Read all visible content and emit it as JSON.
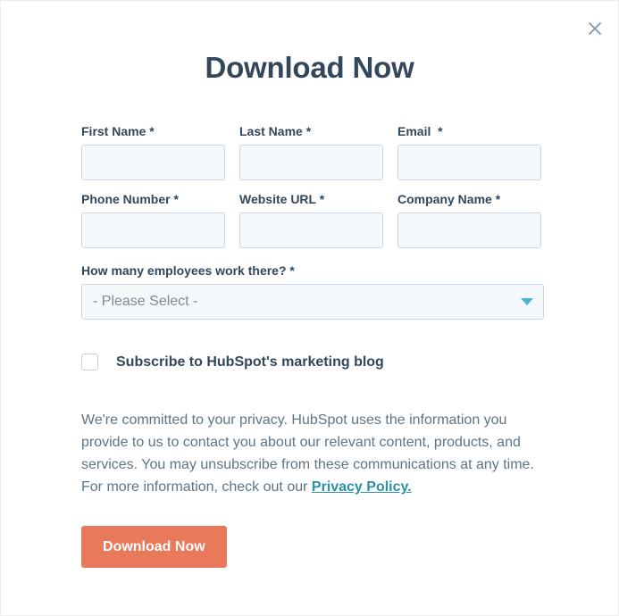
{
  "modal": {
    "title": "Download Now",
    "close_icon": "close-icon",
    "close_label": "Close"
  },
  "form": {
    "rows": [
      {
        "fields": [
          {
            "label": "First Name *",
            "value": "",
            "placeholder": "",
            "name": "first-name"
          },
          {
            "label": "Last Name *",
            "value": "",
            "placeholder": "",
            "name": "last-name"
          },
          {
            "label": "Email  *",
            "value": "",
            "placeholder": "",
            "name": "email"
          }
        ]
      },
      {
        "fields": [
          {
            "label": "Phone Number *",
            "value": "",
            "placeholder": "",
            "name": "phone-number"
          },
          {
            "label": "Website URL *",
            "value": "",
            "placeholder": "",
            "name": "website-url"
          },
          {
            "label": "Company Name *",
            "value": "",
            "placeholder": "",
            "name": "company-name"
          }
        ]
      }
    ],
    "select": {
      "label": "How many employees work there? *",
      "selected": "- Please Select -",
      "caret_icon": "chevron-down-icon"
    },
    "checkbox": {
      "label": "Subscribe to HubSpot's marketing blog",
      "checked": false
    },
    "privacy": {
      "text": "We're committed to your privacy. HubSpot uses the information you provide to us to contact you about our relevant content, products, and services. You may unsubscribe from these communications at any time. For more information, check out our ",
      "link_text": "Privacy Policy."
    },
    "submit_label": "Download Now"
  },
  "colors": {
    "title": "#33475b",
    "label": "#33475b",
    "input_bg": "#f5f8fa",
    "input_border": "#cbd6e2",
    "caret": "#4fb5cc",
    "link": "#2e8fa8",
    "button_bg": "#e8795a",
    "body_text": "#5f7484",
    "close_icon": "#8da2b5"
  }
}
